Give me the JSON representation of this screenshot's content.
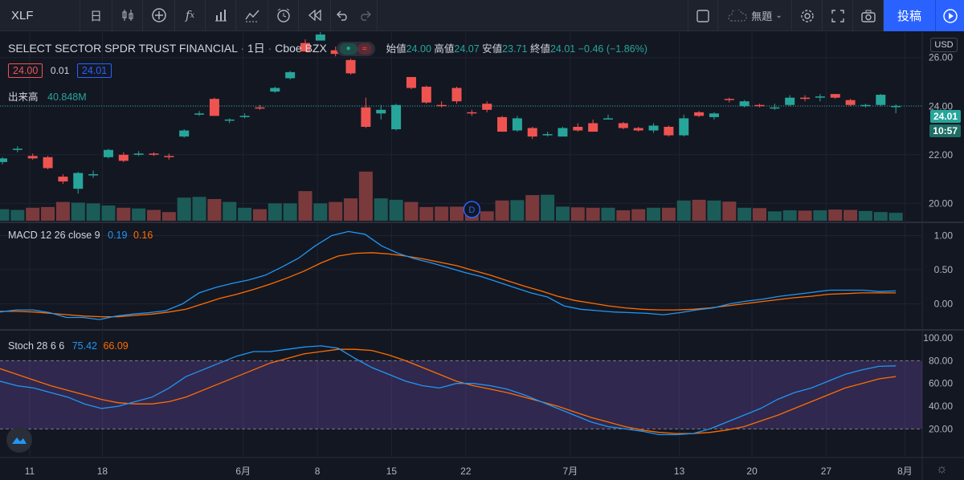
{
  "toolbar": {
    "symbol": "XLF",
    "interval": "日",
    "layout_name": "無題",
    "post_label": "投稿"
  },
  "legend": {
    "title": "SELECT SECTOR SPDR TRUST FINANCIAL",
    "interval": "1日",
    "exchange": "Cboe BZX",
    "open_label": "始値",
    "open": "24.00",
    "high_label": "高値",
    "high": "24.07",
    "low_label": "安値",
    "low": "23.71",
    "close_label": "終値",
    "close": "24.01",
    "change": "−0.46 (−1.86%)",
    "bid": "24.00",
    "spread": "0.01",
    "ask": "24.01",
    "volume_label": "出来高",
    "volume": "40.848M"
  },
  "price_scale": {
    "currency": "USD",
    "ticks": [
      "26.00",
      "24.00",
      "22.00",
      "20.00"
    ],
    "last_price": "24.01",
    "countdown": "10:57"
  },
  "macd": {
    "label": "MACD 12 26 close 9",
    "macd_value": "0.19",
    "signal_value": "0.16",
    "ticks": [
      "1.00",
      "0.50",
      "0.00"
    ]
  },
  "stoch": {
    "label": "Stoch 28 6 6",
    "k_value": "75.42",
    "d_value": "66.09",
    "ticks": [
      "100.00",
      "80.00",
      "60.00",
      "40.00",
      "20.00"
    ]
  },
  "time_axis": [
    "11",
    "18",
    "6月",
    "8",
    "15",
    "22",
    "7月",
    "13",
    "20",
    "27",
    "8月"
  ],
  "event_marker": "D",
  "colors": {
    "up": "#26a69a",
    "down": "#ef5350",
    "macd": "#2196f3",
    "signal": "#ff6d00",
    "stoch_band": "#7e57c2",
    "accent": "#2962ff"
  },
  "chart_data": {
    "type": "candlestick",
    "candles": [
      {
        "o": 21.7,
        "h": 21.9,
        "l": 21.6,
        "c": 21.85
      },
      {
        "o": 22.2,
        "h": 22.35,
        "l": 22.1,
        "c": 22.25
      },
      {
        "o": 21.95,
        "h": 22.05,
        "l": 21.8,
        "c": 21.85
      },
      {
        "o": 21.9,
        "h": 21.95,
        "l": 21.4,
        "c": 21.45
      },
      {
        "o": 21.1,
        "h": 21.2,
        "l": 20.8,
        "c": 20.9
      },
      {
        "o": 20.6,
        "h": 21.3,
        "l": 20.4,
        "c": 21.25
      },
      {
        "o": 21.2,
        "h": 21.35,
        "l": 21.05,
        "c": 21.2
      },
      {
        "o": 21.9,
        "h": 22.25,
        "l": 21.85,
        "c": 22.2
      },
      {
        "o": 22.0,
        "h": 22.1,
        "l": 21.7,
        "c": 21.75
      },
      {
        "o": 22.0,
        "h": 22.15,
        "l": 21.95,
        "c": 22.05
      },
      {
        "o": 22.05,
        "h": 22.1,
        "l": 21.95,
        "c": 22.0
      },
      {
        "o": 21.95,
        "h": 22.05,
        "l": 21.8,
        "c": 21.9
      },
      {
        "o": 22.75,
        "h": 23.05,
        "l": 22.7,
        "c": 23.0
      },
      {
        "o": 23.65,
        "h": 23.8,
        "l": 23.6,
        "c": 23.7
      },
      {
        "o": 24.3,
        "h": 24.35,
        "l": 23.6,
        "c": 23.6
      },
      {
        "o": 23.45,
        "h": 23.5,
        "l": 23.3,
        "c": 23.45
      },
      {
        "o": 23.55,
        "h": 23.7,
        "l": 23.5,
        "c": 23.6
      },
      {
        "o": 23.95,
        "h": 24.05,
        "l": 23.85,
        "c": 23.9
      },
      {
        "o": 24.6,
        "h": 24.8,
        "l": 24.55,
        "c": 24.75
      },
      {
        "o": 25.15,
        "h": 25.45,
        "l": 25.1,
        "c": 25.4
      },
      {
        "o": 26.6,
        "h": 26.75,
        "l": 26.25,
        "c": 26.25
      },
      {
        "o": 26.7,
        "h": 27.1,
        "l": 26.7,
        "c": 26.95
      },
      {
        "o": 26.3,
        "h": 26.45,
        "l": 26.05,
        "c": 26.15
      },
      {
        "o": 25.9,
        "h": 25.95,
        "l": 25.3,
        "c": 25.35
      },
      {
        "o": 23.95,
        "h": 24.35,
        "l": 23.1,
        "c": 23.15
      },
      {
        "o": 23.7,
        "h": 24.05,
        "l": 23.45,
        "c": 23.85
      },
      {
        "o": 23.05,
        "h": 24.1,
        "l": 23.0,
        "c": 24.05
      },
      {
        "o": 25.2,
        "h": 25.2,
        "l": 24.7,
        "c": 24.75
      },
      {
        "o": 24.8,
        "h": 24.85,
        "l": 24.1,
        "c": 24.15
      },
      {
        "o": 24.05,
        "h": 24.2,
        "l": 23.95,
        "c": 24.0
      },
      {
        "o": 24.75,
        "h": 24.8,
        "l": 24.1,
        "c": 24.2
      },
      {
        "o": 23.75,
        "h": 23.85,
        "l": 23.6,
        "c": 23.7
      },
      {
        "o": 24.1,
        "h": 24.2,
        "l": 23.75,
        "c": 23.85
      },
      {
        "o": 23.55,
        "h": 23.6,
        "l": 22.95,
        "c": 22.95
      },
      {
        "o": 23.0,
        "h": 23.6,
        "l": 22.95,
        "c": 23.5
      },
      {
        "o": 23.1,
        "h": 23.15,
        "l": 22.65,
        "c": 22.75
      },
      {
        "o": 22.85,
        "h": 22.95,
        "l": 22.75,
        "c": 22.85
      },
      {
        "o": 22.75,
        "h": 23.15,
        "l": 22.75,
        "c": 23.1
      },
      {
        "o": 23.15,
        "h": 23.3,
        "l": 22.95,
        "c": 23.0
      },
      {
        "o": 23.3,
        "h": 23.45,
        "l": 22.95,
        "c": 22.95
      },
      {
        "o": 23.5,
        "h": 23.65,
        "l": 23.45,
        "c": 23.5
      },
      {
        "o": 23.3,
        "h": 23.35,
        "l": 23.05,
        "c": 23.1
      },
      {
        "o": 23.1,
        "h": 23.15,
        "l": 22.95,
        "c": 23.0
      },
      {
        "o": 23.0,
        "h": 23.3,
        "l": 22.9,
        "c": 23.2
      },
      {
        "o": 23.15,
        "h": 23.2,
        "l": 22.75,
        "c": 22.8
      },
      {
        "o": 22.8,
        "h": 23.65,
        "l": 22.75,
        "c": 23.5
      },
      {
        "o": 23.75,
        "h": 23.8,
        "l": 23.55,
        "c": 23.6
      },
      {
        "o": 23.55,
        "h": 23.75,
        "l": 23.45,
        "c": 23.7
      },
      {
        "o": 24.3,
        "h": 24.35,
        "l": 24.15,
        "c": 24.25
      },
      {
        "o": 24.0,
        "h": 24.25,
        "l": 23.95,
        "c": 24.2
      },
      {
        "o": 24.05,
        "h": 24.1,
        "l": 23.95,
        "c": 24.0
      },
      {
        "o": 23.95,
        "h": 24.1,
        "l": 23.85,
        "c": 23.95
      },
      {
        "o": 24.05,
        "h": 24.45,
        "l": 24.0,
        "c": 24.35
      },
      {
        "o": 24.35,
        "h": 24.45,
        "l": 24.2,
        "c": 24.3
      },
      {
        "o": 24.35,
        "h": 24.5,
        "l": 24.2,
        "c": 24.4
      },
      {
        "o": 24.5,
        "h": 24.5,
        "l": 24.3,
        "c": 24.35
      },
      {
        "o": 24.25,
        "h": 24.3,
        "l": 24.0,
        "c": 24.05
      },
      {
        "o": 24.0,
        "h": 24.1,
        "l": 23.95,
        "c": 24.05
      },
      {
        "o": 24.05,
        "h": 24.5,
        "l": 24.0,
        "c": 24.47
      },
      {
        "o": 24.0,
        "h": 24.07,
        "l": 23.71,
        "c": 24.01
      }
    ],
    "volume_relative": [
      0.32,
      0.3,
      0.36,
      0.38,
      0.52,
      0.5,
      0.48,
      0.42,
      0.36,
      0.34,
      0.3,
      0.24,
      0.64,
      0.66,
      0.6,
      0.52,
      0.36,
      0.32,
      0.48,
      0.48,
      0.82,
      0.48,
      0.52,
      0.62,
      1.36,
      0.62,
      0.58,
      0.52,
      0.38,
      0.39,
      0.39,
      0.4,
      0.26,
      0.56,
      0.57,
      0.71,
      0.72,
      0.39,
      0.37,
      0.36,
      0.36,
      0.29,
      0.32,
      0.36,
      0.36,
      0.56,
      0.58,
      0.56,
      0.53,
      0.36,
      0.35,
      0.26,
      0.29,
      0.28,
      0.29,
      0.31,
      0.3,
      0.27,
      0.24,
      0.22
    ],
    "macd_line": [
      -0.12,
      -0.09,
      -0.09,
      -0.13,
      -0.2,
      -0.2,
      -0.23,
      -0.18,
      -0.15,
      -0.13,
      -0.1,
      0.0,
      0.16,
      0.24,
      0.3,
      0.35,
      0.42,
      0.54,
      0.67,
      0.85,
      1.0,
      1.06,
      1.02,
      0.85,
      0.74,
      0.66,
      0.6,
      0.53,
      0.46,
      0.4,
      0.32,
      0.24,
      0.16,
      0.1,
      -0.03,
      -0.08,
      -0.1,
      -0.12,
      -0.13,
      -0.14,
      -0.16,
      -0.13,
      -0.09,
      -0.06,
      0.0,
      0.04,
      0.07,
      0.11,
      0.14,
      0.17,
      0.2,
      0.2,
      0.2,
      0.18,
      0.19
    ],
    "signal_line": [
      -0.11,
      -0.11,
      -0.12,
      -0.14,
      -0.16,
      -0.18,
      -0.19,
      -0.19,
      -0.17,
      -0.15,
      -0.12,
      -0.08,
      0.0,
      0.08,
      0.14,
      0.21,
      0.29,
      0.38,
      0.48,
      0.6,
      0.7,
      0.74,
      0.75,
      0.73,
      0.7,
      0.66,
      0.61,
      0.56,
      0.49,
      0.42,
      0.34,
      0.26,
      0.19,
      0.11,
      0.05,
      0.01,
      -0.03,
      -0.06,
      -0.08,
      -0.09,
      -0.09,
      -0.08,
      -0.06,
      -0.03,
      0.0,
      0.03,
      0.06,
      0.09,
      0.11,
      0.14,
      0.15,
      0.16,
      0.16,
      0.16
    ],
    "stoch_k": [
      62,
      58,
      56,
      52,
      48,
      42,
      38,
      40,
      44,
      48,
      56,
      66,
      72,
      78,
      84,
      88,
      88,
      90,
      92,
      93,
      91,
      82,
      74,
      68,
      62,
      58,
      56,
      60,
      60,
      58,
      55,
      50,
      44,
      38,
      32,
      26,
      22,
      20,
      18,
      15,
      15,
      16,
      20,
      26,
      32,
      38,
      46,
      52,
      56,
      62,
      68,
      72,
      75,
      75.42
    ],
    "stoch_d": [
      73,
      68,
      63,
      58,
      54,
      50,
      46,
      43,
      42,
      42,
      44,
      48,
      54,
      60,
      66,
      72,
      78,
      82,
      86,
      88,
      90,
      90,
      89,
      85,
      80,
      74,
      68,
      62,
      58,
      55,
      52,
      48,
      44,
      40,
      35,
      30,
      26,
      22,
      19,
      17,
      16,
      16,
      17,
      19,
      22,
      27,
      32,
      38,
      44,
      50,
      56,
      60,
      64,
      66.09
    ]
  }
}
